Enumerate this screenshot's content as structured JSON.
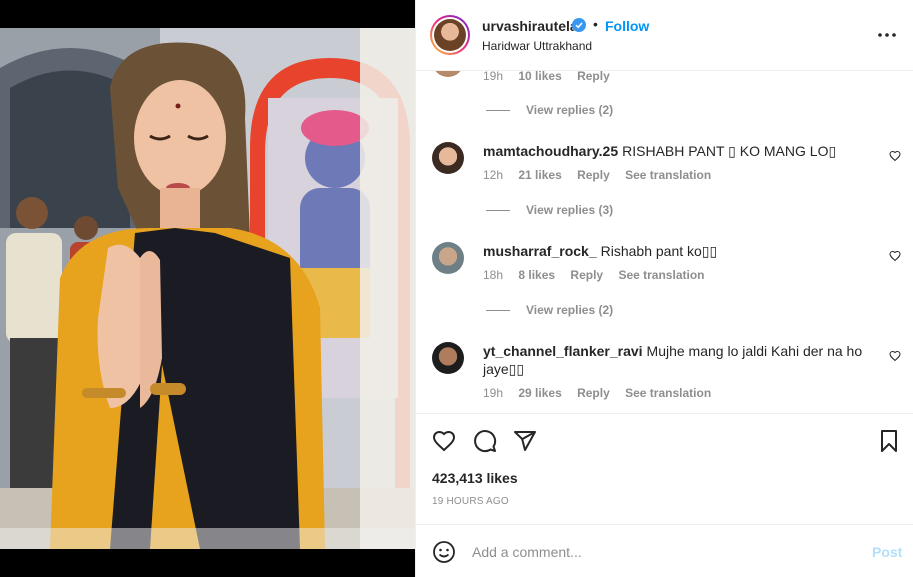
{
  "post": {
    "username": "urvashirautela",
    "follow_label": "Follow",
    "dot": "•",
    "location": "Haridwar Uttrakhand"
  },
  "comments_section": {
    "partial": {
      "time": "19h",
      "likes": "10 likes",
      "reply": "Reply"
    },
    "partial_replies": "View replies (2)",
    "items": [
      {
        "username": "mamtachoudhary.25",
        "text": "RISHABH PANT ▯ KO MANG LO▯",
        "time": "12h",
        "likes": "21 likes",
        "reply": "Reply",
        "translation": "See translation",
        "replies": "View replies (3)"
      },
      {
        "username": "musharraf_rock_",
        "text": "Rishabh pant ko▯▯",
        "time": "18h",
        "likes": "8 likes",
        "reply": "Reply",
        "translation": "See translation",
        "replies": "View replies (2)"
      },
      {
        "username": "yt_channel_flanker_ravi",
        "text": "Mujhe mang lo jaldi Kahi der na ho jaye▯▯",
        "time": "19h",
        "likes": "29 likes",
        "reply": "Reply",
        "translation": "See translation"
      }
    ]
  },
  "actions": {
    "likes": "423,413 likes",
    "timestamp": "19 HOURS AGO"
  },
  "composer": {
    "placeholder": "Add a comment...",
    "post_label": "Post"
  },
  "colors": {
    "link_blue": "#0095f6",
    "post_disabled": "#b2dffc",
    "secondary_text": "#8e8e8e"
  },
  "icons": [
    "verified-icon",
    "more-options-icon",
    "heart-icon",
    "comment-icon",
    "share-icon",
    "bookmark-icon",
    "emoji-icon"
  ]
}
